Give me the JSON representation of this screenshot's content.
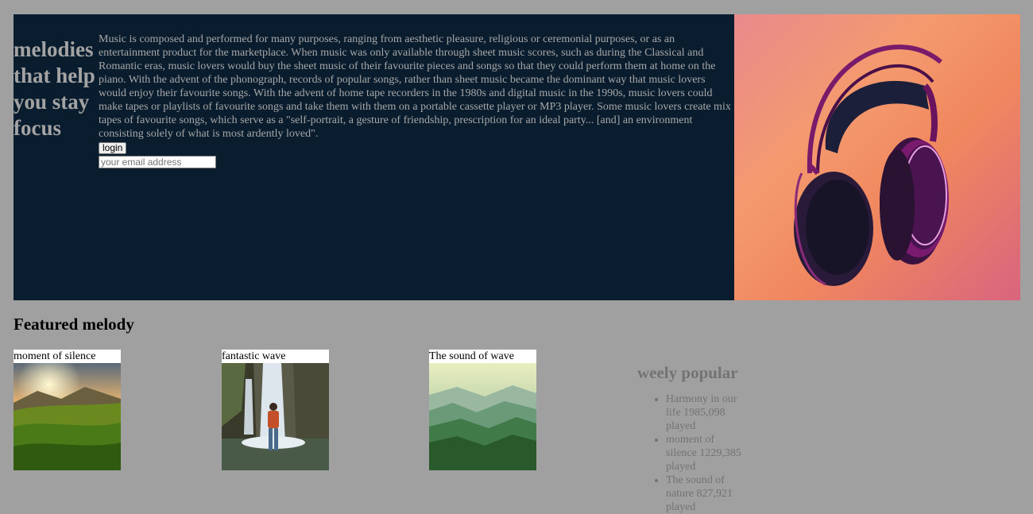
{
  "hero": {
    "title": "melodies that help you stay focus",
    "body": "Music is composed and performed for many purposes, ranging from aesthetic pleasure, religious or ceremonial purposes, or as an entertainment product for the marketplace. When music was only available through sheet music scores, such as during the Classical and Romantic eras, music lovers would buy the sheet music of their favourite pieces and songs so that they could perform them at home on the piano. With the advent of the phonograph, records of popular songs, rather than sheet music became the dominant way that music lovers would enjoy their favourite songs. With the advent of home tape recorders in the 1980s and digital music in the 1990s, music lovers could make tapes or playlists of favourite songs and take them with them on a portable cassette player or MP3 player. Some music lovers create mix tapes of favourite songs, which serve as a \"self-portrait, a gesture of friendship, prescription for an ideal party... [and] an environment consisting solely of what is most ardently loved\".",
    "login_label": "login",
    "email_placeholder": "your email address",
    "image_icon": "headphones-image"
  },
  "featured": {
    "title": "Featured melody",
    "cards": [
      {
        "label": "moment of silence",
        "image": "sunrise-meadow-image"
      },
      {
        "label": "fantastic wave",
        "image": "waterfall-image"
      },
      {
        "label": "The sound of wave",
        "image": "green-mountains-image"
      }
    ]
  },
  "popular": {
    "title": "weely popular",
    "items": [
      "Harmony in our life 1985,098 played",
      "moment of silence 1229,385 played",
      "The sound of nature 827,921 played"
    ]
  },
  "colors": {
    "page_background": "#a0a0a0",
    "hero_background": "#0a1d2f",
    "hero_text": "#a7a7a7",
    "popular_text": "#737373"
  }
}
